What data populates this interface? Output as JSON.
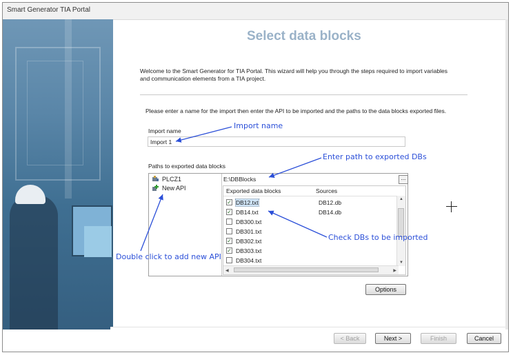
{
  "window": {
    "title": "Smart Generator TIA Portal"
  },
  "heading": "Select data blocks",
  "welcome_text": "Welcome to the Smart Generator for TIA Portal. This wizard will help you through the steps required to import variables and communication elements from a TIA project.",
  "instruction_text": "Please enter a name for the import then enter the API to be imported and the paths to the data blocks exported files.",
  "import_name": {
    "label": "Import name",
    "value": "Import 1"
  },
  "paths": {
    "label": "Paths to exported data blocks",
    "tree": [
      {
        "label": "PLCZ1",
        "icon": "plc-icon"
      },
      {
        "label": "New API",
        "icon": "add-api-icon"
      }
    ],
    "path_value": "E:\\DBBlocks",
    "browse_label": "...",
    "columns": [
      "Exported data blocks",
      "Sources"
    ],
    "rows": [
      {
        "name": "DB12.txt",
        "source": "DB12.db",
        "checked": true,
        "selected": true
      },
      {
        "name": "DB14.txt",
        "source": "DB14.db",
        "checked": true,
        "selected": false
      },
      {
        "name": "DB300.txt",
        "source": "",
        "checked": false,
        "selected": false
      },
      {
        "name": "DB301.txt",
        "source": "",
        "checked": false,
        "selected": false
      },
      {
        "name": "DB302.txt",
        "source": "",
        "checked": true,
        "selected": false
      },
      {
        "name": "DB303.txt",
        "source": "",
        "checked": true,
        "selected": false
      },
      {
        "name": "DB304.txt",
        "source": "",
        "checked": false,
        "selected": false
      }
    ]
  },
  "annotations": {
    "import_name": "Import name",
    "enter_path": "Enter path to exported DBs",
    "check_dbs": "Check DBs to be imported",
    "double_click": "Double click to add new API"
  },
  "buttons": {
    "options": "Options",
    "back": "< Back",
    "next": "Next >",
    "finish": "Finish",
    "cancel": "Cancel"
  },
  "colors": {
    "heading": "#9ab2c8",
    "annotation": "#2b4fd8",
    "selection": "#cfe4f7"
  }
}
